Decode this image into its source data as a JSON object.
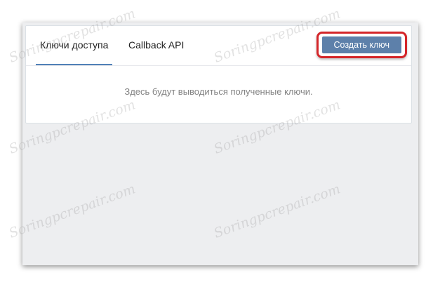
{
  "tabs": [
    {
      "label": "Ключи доступа",
      "active": true
    },
    {
      "label": "Callback API",
      "active": false
    }
  ],
  "create_button": {
    "label": "Создать ключ"
  },
  "empty_message": "Здесь будут выводиться полученные ключи.",
  "watermark": "Soringpcrepair.com",
  "colors": {
    "accent": "#5181b8",
    "button": "#5d80aa",
    "highlight": "#d4262a",
    "background": "#edeef0"
  }
}
